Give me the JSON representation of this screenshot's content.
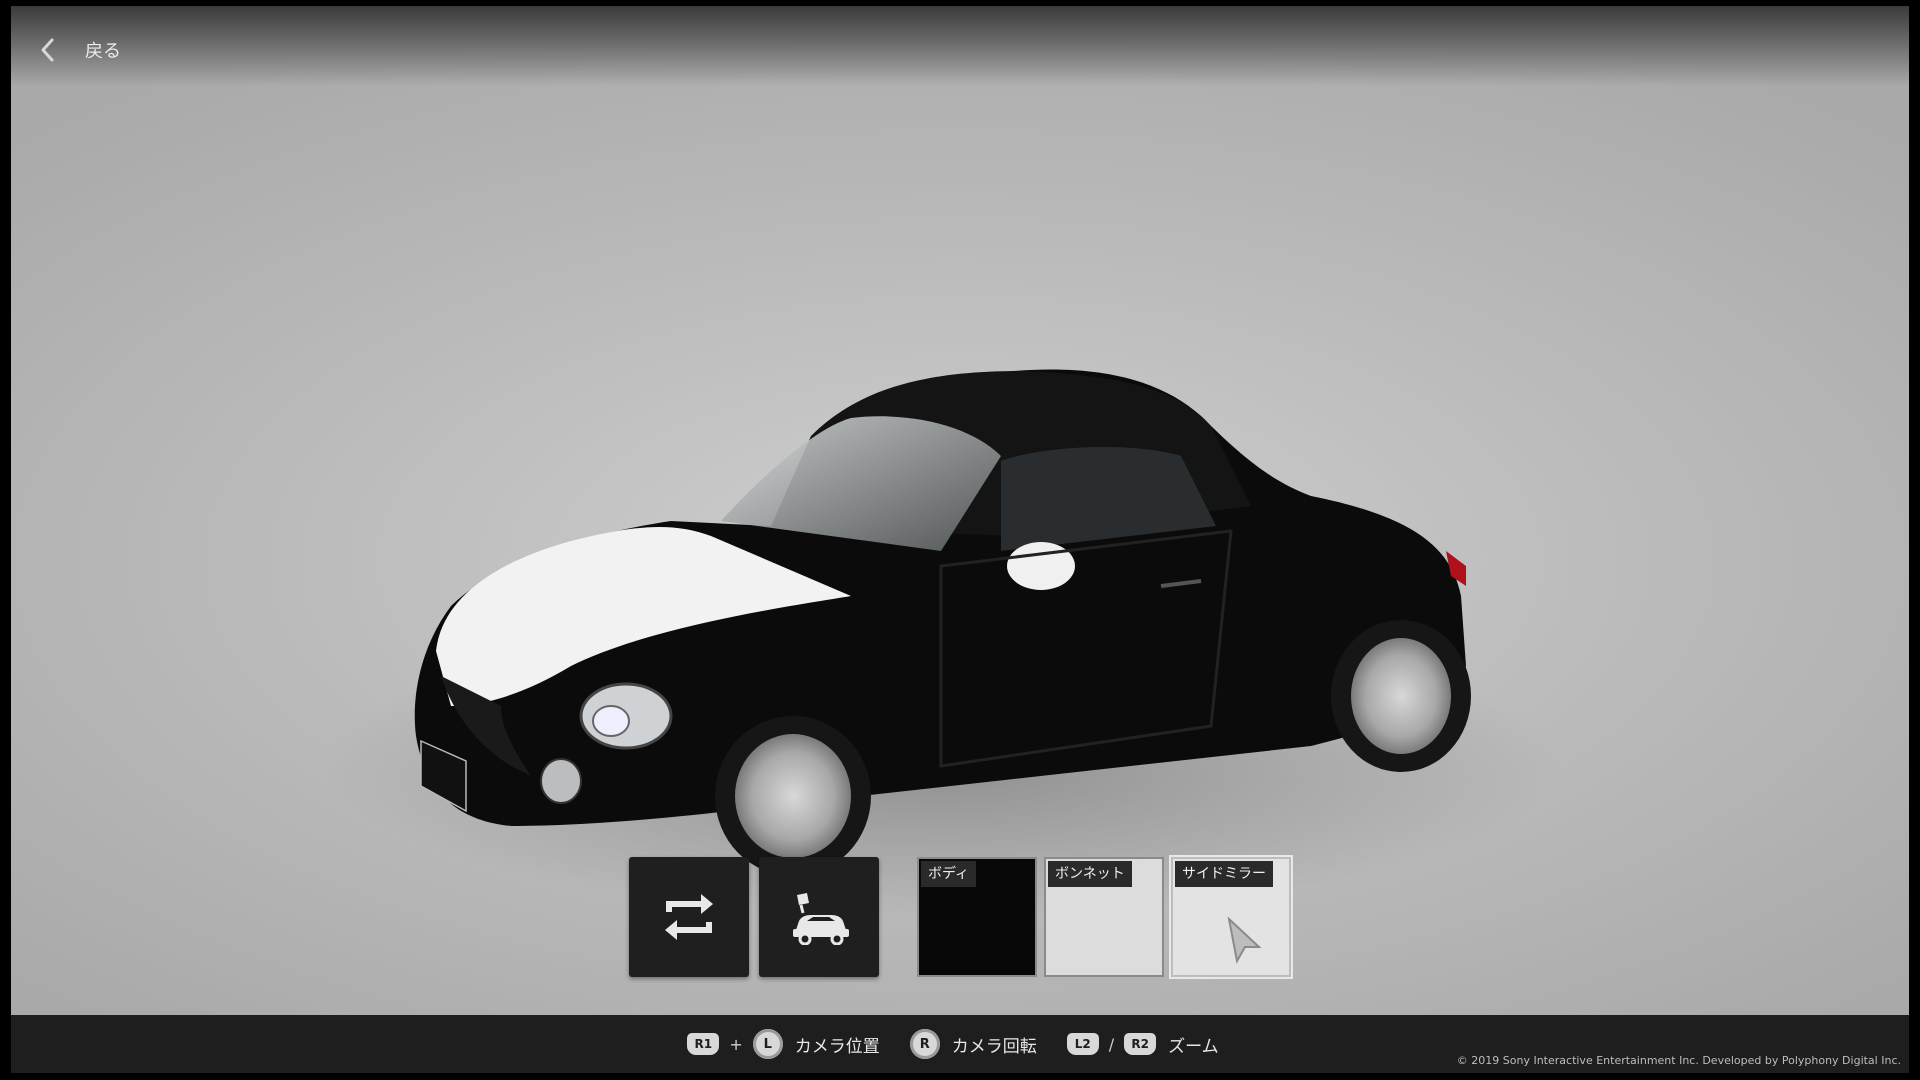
{
  "header": {
    "back_label": "戻る"
  },
  "tiles": [
    {
      "id": "rotate",
      "icon": "swap-arrows-icon"
    },
    {
      "id": "paint",
      "icon": "car-paint-icon"
    }
  ],
  "swatches": [
    {
      "label": "ボディ",
      "color": "#080808"
    },
    {
      "label": "ボンネット",
      "color": "#dcdcdc"
    },
    {
      "label": "サイドミラー",
      "color": "#e3e3e3",
      "selected": true
    }
  ],
  "controls": {
    "r1": "R1",
    "plus": "+",
    "l_stick": "L",
    "camera_position": "カメラ位置",
    "r_stick": "R",
    "camera_rotate": "カメラ回転",
    "l2": "L2",
    "slash": "/",
    "r2": "R2",
    "zoom": "ズーム"
  },
  "copyright": "© 2019 Sony Interactive Entertainment Inc. Developed by Polyphony Digital Inc."
}
